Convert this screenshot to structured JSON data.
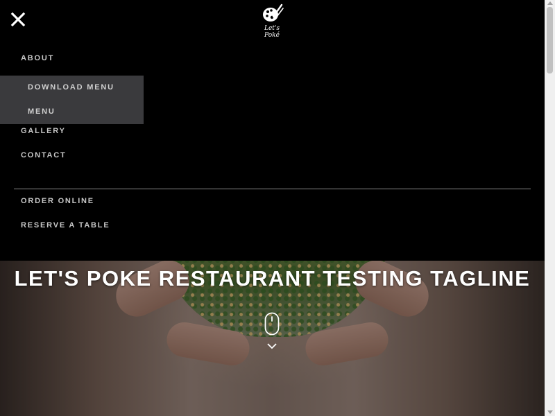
{
  "logo": {
    "text": "Let's Poké"
  },
  "icons": {
    "close": "close-icon",
    "logo": "palette-logo-icon",
    "mouse": "mouse-scroll-icon",
    "chevron": "chevron-down-icon"
  },
  "nav": {
    "items": [
      {
        "label": "ABOUT"
      },
      {
        "label": "GALLERY"
      },
      {
        "label": "CONTACT"
      }
    ],
    "submenu": [
      {
        "label": "DOWNLOAD MENU"
      },
      {
        "label": "MENU"
      }
    ],
    "secondary": [
      {
        "label": "ORDER ONLINE"
      },
      {
        "label": "RESERVE A TABLE"
      }
    ]
  },
  "hero": {
    "tagline": "LET'S POKE RESTAURANT TESTING TAGLINE"
  },
  "colors": {
    "nav_background": "#000000",
    "submenu_background": "#3a3a3d",
    "text": "#c8c8c8"
  }
}
